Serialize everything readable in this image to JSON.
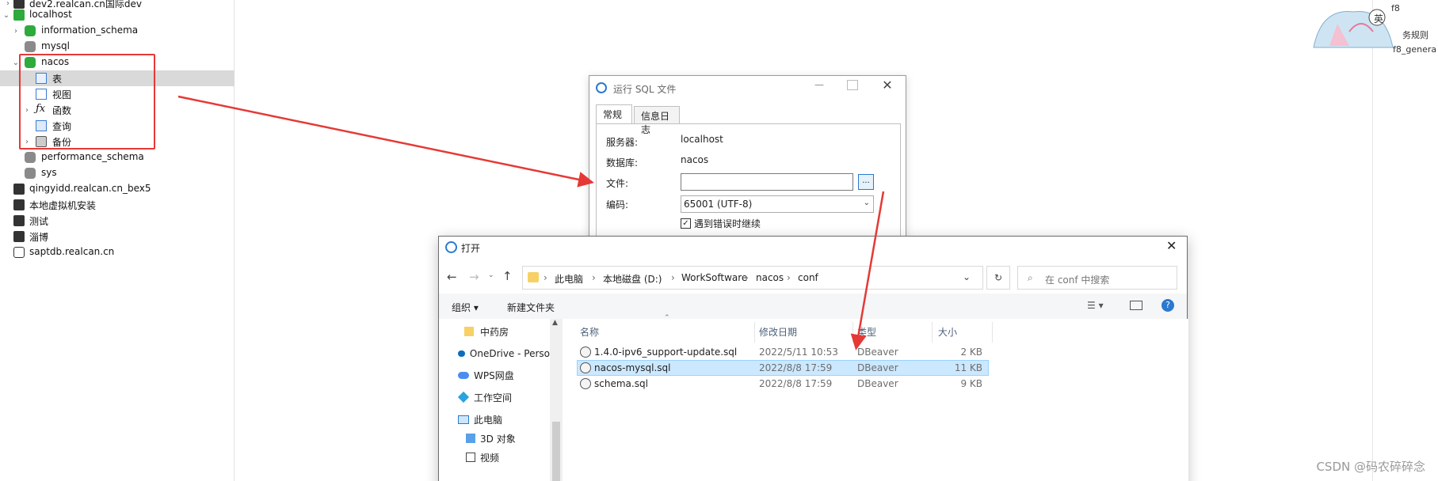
{
  "tree": {
    "items": [
      {
        "label": "dev2.realcan.cn国际dev",
        "level": 0,
        "icon": "connection-icon"
      },
      {
        "label": "localhost",
        "level": 0,
        "icon": "connection-icon",
        "expanded": true
      },
      {
        "label": "information_schema",
        "level": 1,
        "icon": "database-green-icon"
      },
      {
        "label": "mysql",
        "level": 1,
        "icon": "database-gray-icon"
      },
      {
        "label": "nacos",
        "level": 1,
        "icon": "database-green-icon",
        "expanded": true
      },
      {
        "label": "表",
        "level": 2,
        "icon": "table-icon",
        "selected": true
      },
      {
        "label": "视图",
        "level": 2,
        "icon": "view-icon"
      },
      {
        "label": "函数",
        "level": 2,
        "icon": "function-icon"
      },
      {
        "label": "查询",
        "level": 2,
        "icon": "query-icon"
      },
      {
        "label": "备份",
        "level": 2,
        "icon": "backup-icon"
      },
      {
        "label": "performance_schema",
        "level": 1,
        "icon": "database-gray-icon"
      },
      {
        "label": "sys",
        "level": 1,
        "icon": "database-gray-icon"
      },
      {
        "label": "qingyidd.realcan.cn_bex5",
        "level": 0,
        "icon": "connection-icon"
      },
      {
        "label": "本地虚拟机安装",
        "level": 0,
        "icon": "connection-icon"
      },
      {
        "label": "测试",
        "level": 0,
        "icon": "connection-icon"
      },
      {
        "label": "淄博",
        "level": 0,
        "icon": "connection-icon"
      },
      {
        "label": "saptdb.realcan.cn",
        "level": 0,
        "icon": "connection-icon"
      }
    ]
  },
  "deco": {
    "lines": [
      "f8",
      "英",
      "务规则",
      "f8_genera"
    ]
  },
  "sql_dialog": {
    "title": "运行 SQL 文件",
    "tabs": [
      "常规",
      "信息日志"
    ],
    "server_label": "服务器:",
    "server_value": "localhost",
    "db_label": "数据库:",
    "db_value": "nacos",
    "file_label": "文件:",
    "file_value": "",
    "browse_label": "...",
    "encoding_label": "编码:",
    "encoding_value": "65001 (UTF-8)",
    "continue_label": "遇到错误时继续",
    "continue_checked": true
  },
  "open_dialog": {
    "title": "打开",
    "breadcrumb": [
      "此电脑",
      "本地磁盘 (D:)",
      "WorkSoftware",
      "nacos",
      "conf"
    ],
    "search_placeholder": "在 conf 中搜索",
    "organize_label": "组织 ▾",
    "new_folder_label": "新建文件夹",
    "nav": [
      {
        "label": "中药房",
        "icon": "folder-icon"
      },
      {
        "label": "OneDrive - Perso",
        "icon": "onedrive-icon"
      },
      {
        "label": "WPS网盘",
        "icon": "wps-cloud-icon"
      },
      {
        "label": "工作空间",
        "icon": "workspace-icon"
      },
      {
        "label": "此电脑",
        "icon": "computer-icon"
      },
      {
        "label": "3D 对象",
        "icon": "3d-objects-icon"
      },
      {
        "label": "视频",
        "icon": "video-icon"
      }
    ],
    "columns": [
      "名称",
      "修改日期",
      "类型",
      "大小"
    ],
    "files": [
      {
        "name": "1.4.0-ipv6_support-update.sql",
        "date": "2022/5/11 10:53",
        "type": "DBeaver",
        "size": "2 KB"
      },
      {
        "name": "nacos-mysql.sql",
        "date": "2022/8/8 17:59",
        "type": "DBeaver",
        "size": "11 KB",
        "selected": true
      },
      {
        "name": "schema.sql",
        "date": "2022/8/8 17:59",
        "type": "DBeaver",
        "size": "9 KB"
      }
    ]
  },
  "watermark": "CSDN @码农碎碎念",
  "colors": {
    "highlight": "#e53935",
    "selection": "#cce8ff",
    "accent": "#2b79d0"
  }
}
